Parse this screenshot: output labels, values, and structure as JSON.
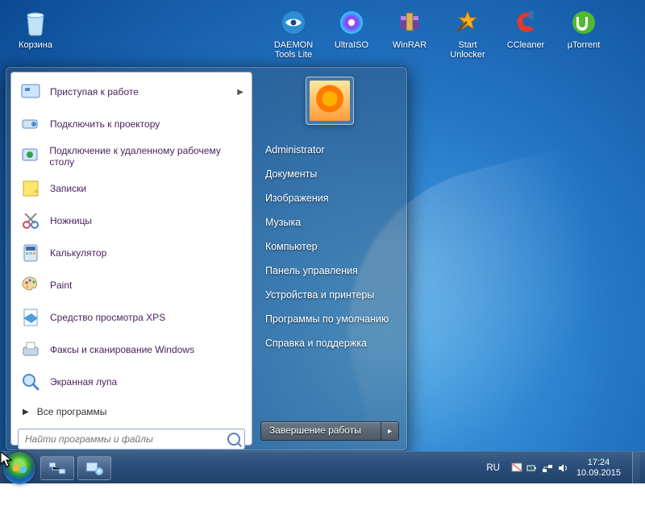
{
  "desktop_icons": [
    {
      "label": "Корзина",
      "icon": "recycle-bin-icon"
    },
    {
      "label": "DAEMON Tools Lite",
      "icon": "daemon-tools-icon"
    },
    {
      "label": "UltraISO",
      "icon": "ultraiso-icon"
    },
    {
      "label": "WinRAR",
      "icon": "winrar-icon"
    },
    {
      "label": "Start Unlocker",
      "icon": "start-unlocker-icon"
    },
    {
      "label": "CCleaner",
      "icon": "ccleaner-icon"
    },
    {
      "label": "µTorrent",
      "icon": "utorrent-icon"
    }
  ],
  "start_menu": {
    "programs": [
      {
        "label": "Приступая к работе",
        "has_submenu": true,
        "icon": "getting-started-icon"
      },
      {
        "label": "Подключить к проектору",
        "icon": "projector-icon"
      },
      {
        "label": "Подключение к удаленному рабочему столу",
        "icon": "remote-desktop-icon"
      },
      {
        "label": "Записки",
        "icon": "sticky-notes-icon"
      },
      {
        "label": "Ножницы",
        "icon": "snipping-tool-icon"
      },
      {
        "label": "Калькулятор",
        "icon": "calculator-icon"
      },
      {
        "label": "Paint",
        "icon": "paint-icon"
      },
      {
        "label": "Средство просмотра XPS",
        "icon": "xps-viewer-icon"
      },
      {
        "label": "Факсы и сканирование Windows",
        "icon": "fax-scan-icon"
      },
      {
        "label": "Экранная лупа",
        "icon": "magnifier-icon"
      }
    ],
    "all_programs_label": "Все программы",
    "search_placeholder": "Найти программы и файлы",
    "right_items": [
      "Administrator",
      "Документы",
      "Изображения",
      "Музыка",
      "Компьютер",
      "Панель управления",
      "Устройства и принтеры",
      "Программы по умолчанию",
      "Справка и поддержка"
    ],
    "shutdown_label": "Завершение работы"
  },
  "taskbar": {
    "lang": "RU",
    "time": "17:24",
    "date": "10.09.2015"
  }
}
